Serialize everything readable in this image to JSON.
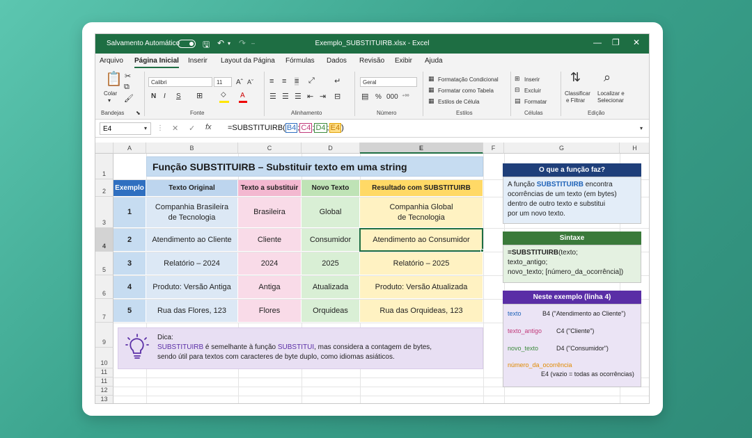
{
  "window": {
    "autosave_label": "Salvamento Automático",
    "doc_title": "Exemplo_SUBSTITUIRB.xlsx  -  Excel"
  },
  "menu": [
    "Arquivo",
    "Página Inicial",
    "Inserir",
    "Layout da Página",
    "Fórmulas",
    "Dados",
    "Revisão",
    "Exibir",
    "Ajuda"
  ],
  "ribbon": {
    "paste_label": "Colar",
    "font_name": "Calibri",
    "font_size": "11",
    "bold": "N",
    "italic": "I",
    "underline": "S",
    "number_format": "Geral",
    "cond_format": "Formatação Condicional",
    "format_table": "Formatar como Tabela",
    "cell_styles": "Estilos de Célula",
    "insert": "Inserir",
    "delete": "Excluir",
    "format": "Formatar",
    "sort_filter_1": "Classificar",
    "sort_filter_2": "e Filtrar",
    "find_1": "Localizar e",
    "find_2": "Selecionar",
    "groups": {
      "clipboard": "Bandejas",
      "font": "Fonte",
      "alignment": "Alinhamento",
      "number": "Número",
      "styles": "Estilos",
      "cells": "Células",
      "editing": "Edição"
    }
  },
  "formula_bar": {
    "name_box": "E4",
    "prefix": "=SUBSTITUIRB(",
    "ref1": "B4",
    "ref2": "C4",
    "ref3": "D4",
    "ref4": "E4",
    "sep": ";",
    "suffix": ")"
  },
  "columns": [
    "A",
    "B",
    "C",
    "D",
    "E",
    "F",
    "G",
    "H"
  ],
  "rows": [
    "1",
    "2",
    "3",
    "4",
    "5",
    "6",
    "7",
    "9",
    "10",
    "11",
    "11",
    "12",
    "13"
  ],
  "sheet": {
    "title": "Função SUBSTITUIRB – Substituir texto em uma string",
    "headers": [
      "Exemplo",
      "Texto Original",
      "Texto a substituir",
      "Novo Texto",
      "Resultado com SUBSTITUIRB"
    ],
    "table": [
      [
        "1",
        "Companhia Brasileira\nde Tecnologia",
        "Brasileira",
        "Global",
        "Companhia Global\nde Tecnologia"
      ],
      [
        "2",
        "Atendimento ao Cliente",
        "Cliente",
        "Consumidor",
        "Atendimento ao Consumidor"
      ],
      [
        "3",
        "Relatório – 2024",
        "2024",
        "2025",
        "Relatório – 2025"
      ],
      [
        "4",
        "Produto: Versão Antiga",
        "Antiga",
        "Atualizada",
        "Produto: Versão Atualizada"
      ],
      [
        "5",
        "Rua das Flores, 123",
        "Flores",
        "Orquideas",
        "Rua das Orquideas, 123"
      ]
    ],
    "tip_title": "Dica:",
    "tip_kw1": "SUBSTITUIRB",
    "tip_mid": " é semelhante à função ",
    "tip_kw2": "SUBSTITUI",
    "tip_rest": ", mas considera a contagem de bytes,",
    "tip_line3": "sendo útil para textos com caracteres de byte duplo, como idiomas asiáticos."
  },
  "panel": {
    "what_title": "O que a função faz?",
    "what_pre": "A função ",
    "what_kw": "SUBSTITUIRB",
    "what_post": " encontra",
    "what_l2": "ocorrências de um texto (em bytes)",
    "what_l3": "dentro de outro texto e substitui",
    "what_l4": "por um novo texto.",
    "syntax_title": "Sintaxe",
    "syntax_kw": "=SUBSTITUIRB",
    "syntax_l1": "(texto;",
    "syntax_l2": "texto_antigo;",
    "syntax_l3": "novo_texto; [número_da_ocorrência])",
    "example_title": "Neste exemplo (linha 4)",
    "args": [
      {
        "name": "texto",
        "value": "B4 (\"Atendimento ao Cliente\")",
        "color": "#1f63b8"
      },
      {
        "name": "texto_antigo",
        "value": "C4 (\"Cliente\")",
        "color": "#c13a7a"
      },
      {
        "name": "novo_texto",
        "value": "D4 (\"Consumidor\")",
        "color": "#3d8b3d"
      },
      {
        "name": "número_da_ocorrência",
        "value": "E4 (vazio = todas as ocorrências)",
        "color": "#e08a00"
      }
    ]
  },
  "colors": {
    "excel_green": "#1e6e43",
    "blue": "#c6dcf1",
    "pink": "#f9dbe8",
    "green": "#d9efd5",
    "yellow": "#fff2c2",
    "purple": "#e8dff3",
    "panel_navy": "#1f3f7a",
    "panel_green": "#3a7a3a",
    "panel_purple": "#5a2ea6"
  }
}
